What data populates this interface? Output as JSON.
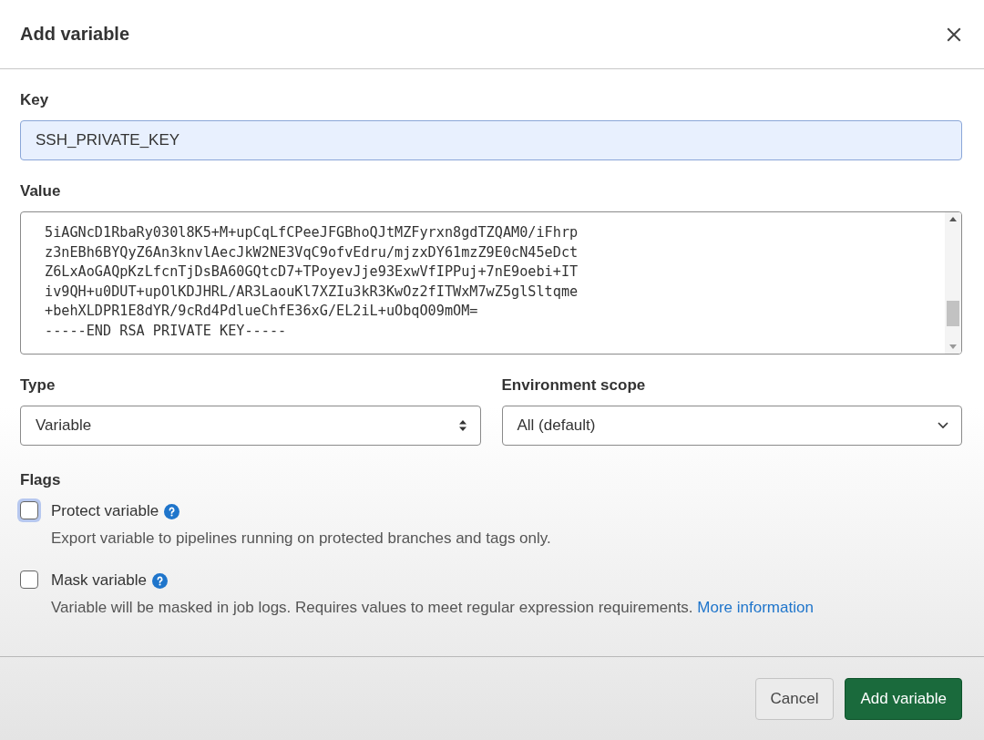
{
  "dialog": {
    "title": "Add variable"
  },
  "key": {
    "label": "Key",
    "value": "SSH_PRIVATE_KEY"
  },
  "value": {
    "label": "Value",
    "lines": [
      "5iAGNcD1RbaRy030l8K5+M+upCqLfCPeeJFGBhoQJtMZFyrxn8gdTZQAM0/iFhrp",
      "z3nEBh6BYQyZ6An3knvlAecJkW2NE3VqC9ofvEdru/mjzxDY61mzZ9E0cN45eDct",
      "Z6LxAoGAQpKzLfcnTjDsBA60GQtcD7+TPoyevJje93ExwVfIPPuj+7nE9oebi+IT",
      "iv9QH+u0DUT+upOlKDJHRL/AR3LaouKl7XZIu3kR3KwOz2fITWxM7wZ5glSltqme",
      "+behXLDPR1E8dYR/9cRd4PdlueChfE36xG/EL2iL+uObqO09mOM=",
      "-----END RSA PRIVATE KEY-----"
    ]
  },
  "type": {
    "label": "Type",
    "value": "Variable"
  },
  "environment_scope": {
    "label": "Environment scope",
    "value": "All (default)"
  },
  "flags": {
    "label": "Flags",
    "items": [
      {
        "label": "Protect variable",
        "checked": false,
        "focused": true,
        "description": "Export variable to pipelines running on protected branches and tags only."
      },
      {
        "label": "Mask variable",
        "checked": false,
        "focused": false,
        "description": "Variable will be masked in job logs. Requires values to meet regular expression requirements.",
        "link": "More information"
      }
    ]
  },
  "buttons": [
    {
      "kind": "secondary",
      "label": "Cancel"
    },
    {
      "kind": "primary",
      "label": "Add variable"
    }
  ]
}
